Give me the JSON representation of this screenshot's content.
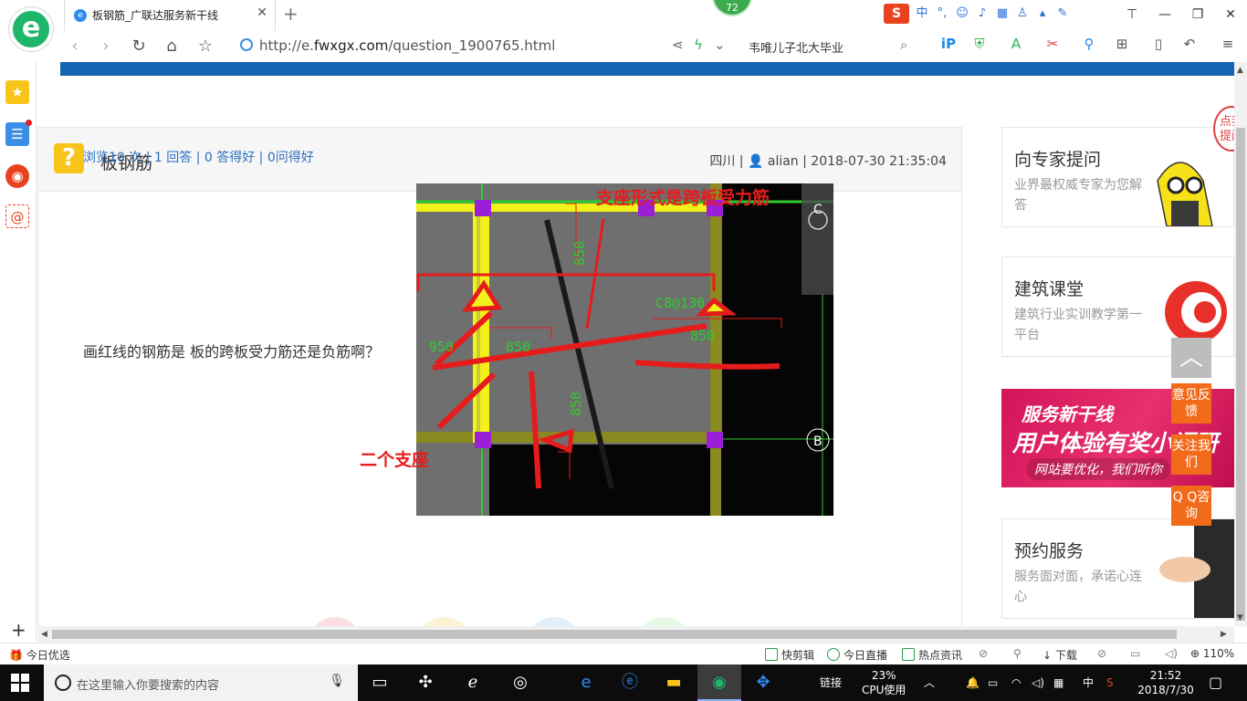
{
  "browser": {
    "tab_title": "板钢筋_广联达服务新干线",
    "tab_close": "✕",
    "new_tab": "+",
    "score": "72",
    "url_prefix": "http://e.",
    "url_domain": "fwxgx.com",
    "url_path": "/question_1900765.html",
    "search_text": "韦唯儿子北大毕业",
    "ime_label": "中",
    "logo_letter": "e",
    "sogou_letter": "S"
  },
  "sidebar": {
    "add_label": "+"
  },
  "question": {
    "icon_glyph": "?",
    "title": "板钢筋",
    "region": "四川",
    "author": "alian",
    "datetime": "2018-07-30 21:35:04",
    "views": "浏览10 次",
    "answers": "1 回答",
    "good_answers": "0 答得好",
    "good_questions": "0问得好",
    "body": "画红线的钢筋是 板的跨板受力筋还是负筋啊？"
  },
  "image": {
    "annotation_top": "支座形式是跨板受力筋",
    "annotation_left": "二个支座",
    "labels": {
      "c8": "C8@130",
      "d850_top": "850",
      "d950": "950",
      "d850_mid": "850",
      "d850_v": "850",
      "d850_r": "850",
      "axis_c": "C",
      "axis_b": "B"
    }
  },
  "right": {
    "card1_title": "向专家提问",
    "card1_sub": "业界最权威专家为您解答",
    "card2_title": "建筑课堂",
    "card2_sub": "建筑行业实训教学第一平台",
    "ad_line1": "服务新干线",
    "ad_line2": "用户体验有奖小调研",
    "ad_line3": "网站要优化，我们听你",
    "card3_title": "预约服务",
    "card3_sub": "服务面对面，承诺心连心",
    "corner_text": "点我提问",
    "float_top": "︿",
    "feedback": "意见反馈",
    "follow": "关注我们",
    "qq": "Q Q咨询"
  },
  "statusbar": {
    "left": "今日优选",
    "clip": "快剪辑",
    "live": "今日直播",
    "news": "热点资讯",
    "download": "下载",
    "zoom": "110%"
  },
  "taskbar": {
    "search_placeholder": "在这里输入你要搜索的内容",
    "links": "链接",
    "cpu_pct": "23%",
    "cpu_label": "CPU使用",
    "ime": "中",
    "time": "21:52",
    "date": "2018/7/30"
  },
  "colors": {
    "accent_blue": "#1565b5",
    "link_blue": "#2c6fbd",
    "annotation_red": "#e61c1c",
    "float_orange": "#f26b1a",
    "question_yellow": "#f7c51a"
  }
}
